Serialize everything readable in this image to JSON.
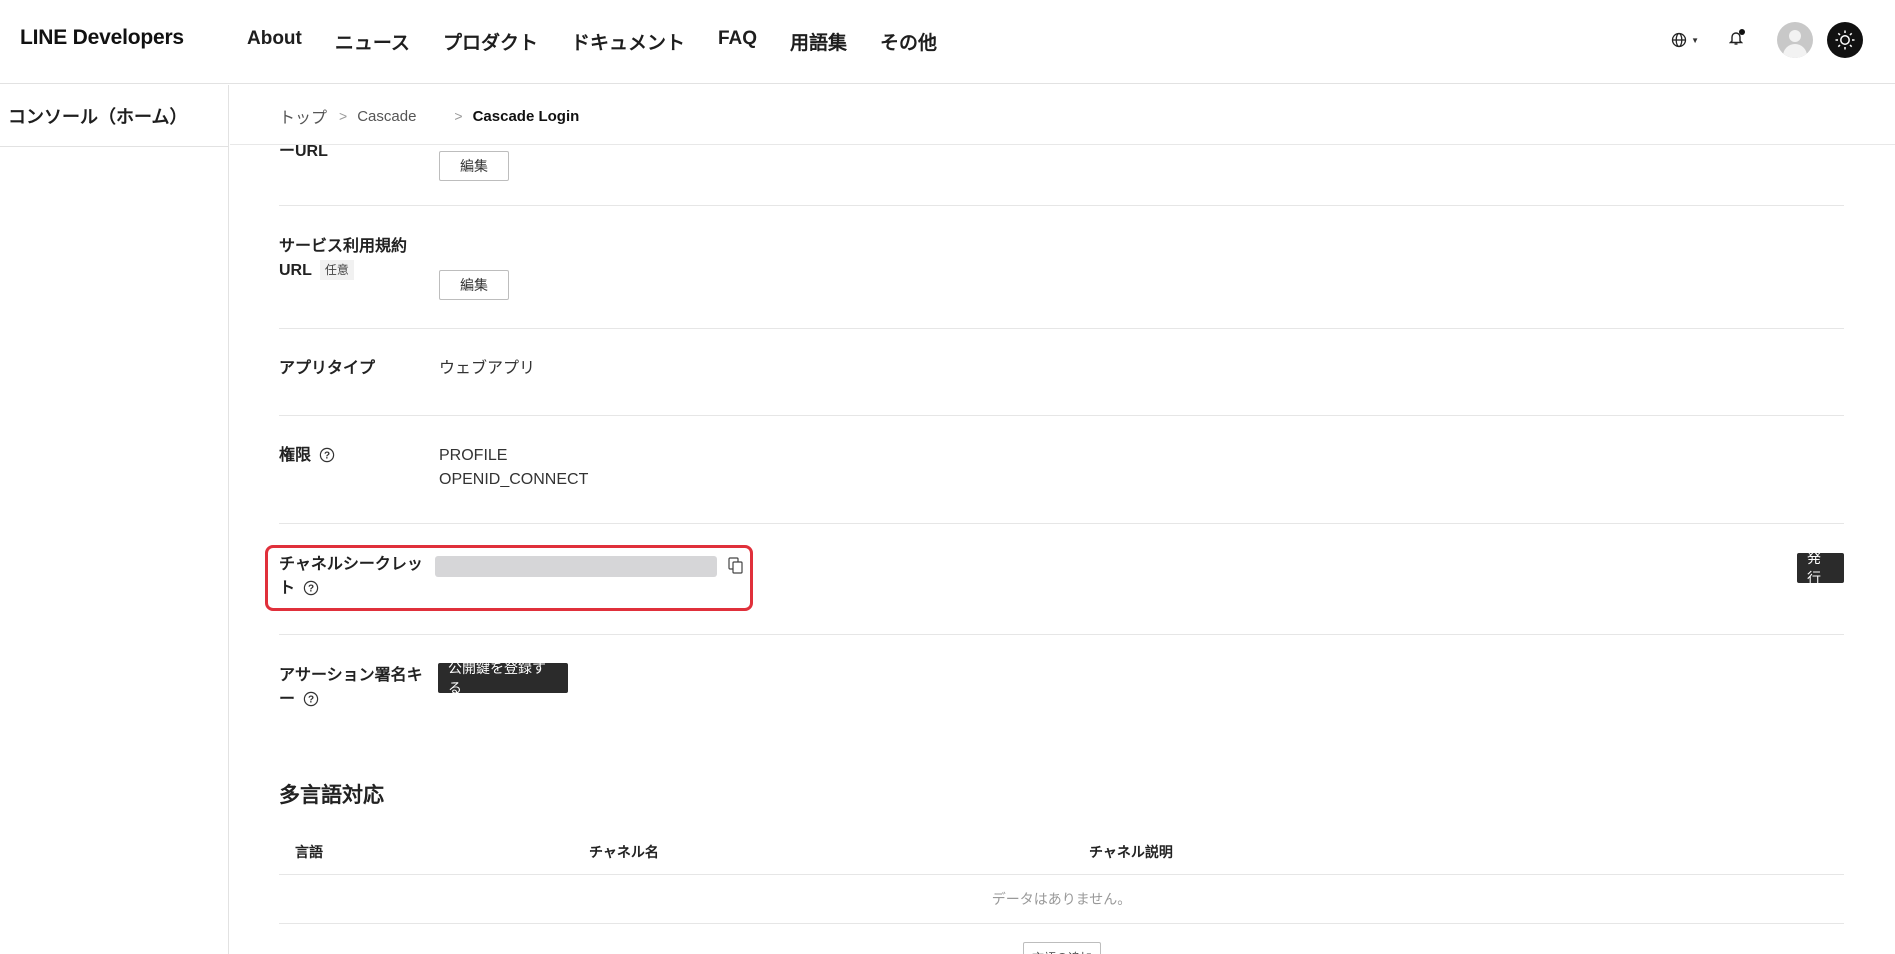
{
  "header": {
    "logo": "LINE Developers",
    "nav": [
      "About",
      "ニュース",
      "プロダクト",
      "ドキュメント",
      "FAQ",
      "用語集",
      "その他"
    ],
    "icons": [
      "globe-icon",
      "bell-icon",
      "avatar",
      "theme-toggle-icon"
    ]
  },
  "sidebar": {
    "home_label": "コンソール（ホーム）"
  },
  "breadcrumb": {
    "top": "トップ",
    "provider": "Cascade",
    "current": "Cascade Login"
  },
  "settings": {
    "privacy_url": {
      "label": "ーURL",
      "edit_label": "編集"
    },
    "terms_url": {
      "label_line1": "サービス利用規約",
      "label_line2": "URL",
      "optional_tag": "任意",
      "edit_label": "編集"
    },
    "app_type": {
      "label": "アプリタイプ",
      "value": "ウェブアプリ"
    },
    "permissions": {
      "label": "権限",
      "values": [
        "PROFILE",
        "OPENID_CONNECT"
      ]
    },
    "channel_secret": {
      "label_line1": "チャネルシークレッ",
      "label_line2": "ト",
      "issue_label": "発行"
    },
    "assertion_key": {
      "label_line1": "アサーション署名キ",
      "label_line2": "ー",
      "register_label": "公開鍵を登録する"
    }
  },
  "multilang": {
    "title": "多言語対応",
    "columns": [
      "言語",
      "チャネル名",
      "チャネル説明"
    ],
    "empty_text": "データはありません。",
    "add_label": "言語の追加"
  },
  "colors": {
    "highlight": "#e0303b",
    "dark_button": "#2b2b2b"
  }
}
